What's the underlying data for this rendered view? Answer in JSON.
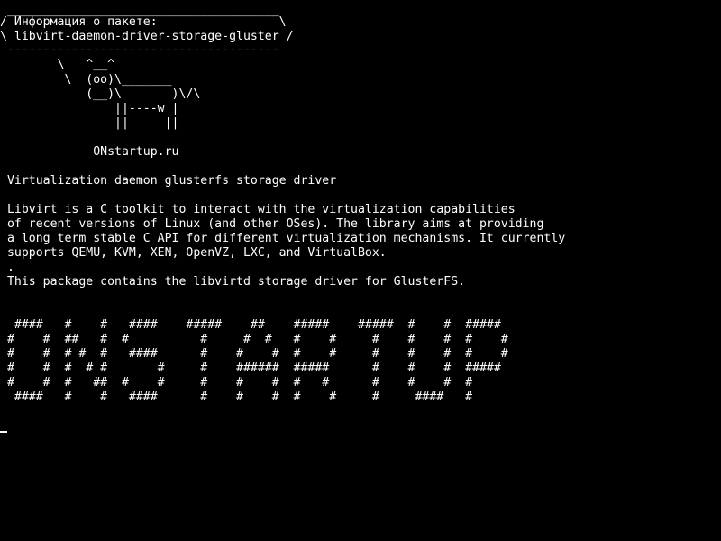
{
  "terminal": {
    "foreground": "#ffffff",
    "background": "#000000",
    "bubble": [
      " ______________________________________",
      "/ Информация о пакете:                 \\",
      "\\ libvirt-daemon-driver-storage-gluster /",
      " --------------------------------------"
    ],
    "cow": [
      "        \\   ^__^",
      "         \\  (oo)\\_______",
      "            (__)\\       )\\/\\",
      "                ||----w |",
      "                ||     ||"
    ],
    "site": "             ONstartup.ru",
    "summary": " Virtualization daemon glusterfs storage driver",
    "description": [
      " Libvirt is a C toolkit to interact with the virtualization capabilities",
      " of recent versions of Linux (and other OSes). The library aims at providing",
      " a long term stable C API for different virtualization mechanisms. It currently",
      " supports QEMU, KVM, XEN, OpenVZ, LXC, and VirtualBox.",
      " .",
      " This package contains the libvirtd storage driver for GlusterFS."
    ],
    "banner": [
      "  ####   #    #   ####    #####    ##    #####    #####  #    #  #####",
      " #    #  ##   #  #          #     #  #   #    #     #    #    #  #    #",
      " #    #  # #  #   ####      #    #    #  #    #     #    #    #  #    #",
      " #    #  #  # #       #     #    ######  #####      #    #    #  #####",
      " #    #  #   ##  #    #     #    #    #  #   #      #    #    #  #",
      "  ####   #    #   ####      #    #    #  #    #     #     ####   #"
    ]
  }
}
